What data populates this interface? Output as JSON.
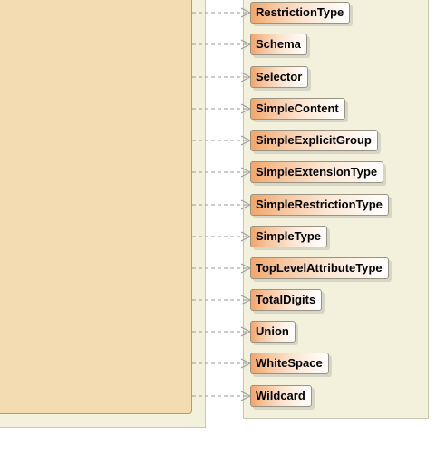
{
  "nodes": [
    {
      "label": "RestrictionType"
    },
    {
      "label": "Schema"
    },
    {
      "label": "Selector"
    },
    {
      "label": "SimpleContent"
    },
    {
      "label": "SimpleExplicitGroup"
    },
    {
      "label": "SimpleExtensionType"
    },
    {
      "label": "SimpleRestrictionType"
    },
    {
      "label": "SimpleType"
    },
    {
      "label": "TopLevelAttributeType"
    },
    {
      "label": "TotalDigits"
    },
    {
      "label": "Union"
    },
    {
      "label": "WhiteSpace"
    },
    {
      "label": "Wildcard"
    }
  ],
  "colors": {
    "node_fill_start": "#f2a66a",
    "node_fill_end": "#ffffff",
    "class_fill": "#f3dcb2",
    "package_fill": "#f3f1dc",
    "connector": "#999999"
  }
}
